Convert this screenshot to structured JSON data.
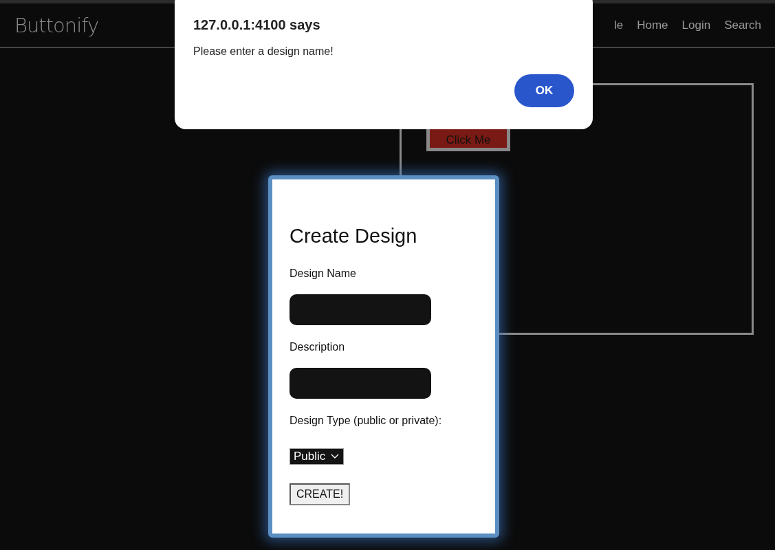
{
  "navbar": {
    "brand": "Buttonify",
    "links": [
      {
        "label": "le"
      },
      {
        "label": "Home"
      },
      {
        "label": "Login"
      },
      {
        "label": "Search"
      }
    ]
  },
  "preview": {
    "button_label": "Click Me"
  },
  "form": {
    "title": "Create Design",
    "fields": [
      {
        "kind": "text",
        "label": "Design Name"
      },
      {
        "kind": "text",
        "label": "Description"
      },
      {
        "kind": "select",
        "label": "Design Type (public or private):",
        "value": "Public"
      }
    ],
    "submit": "CREATE!"
  },
  "dialog": {
    "title": "127.0.0.1:4100 says",
    "message": "Please enter a design name!",
    "button": "OK"
  }
}
